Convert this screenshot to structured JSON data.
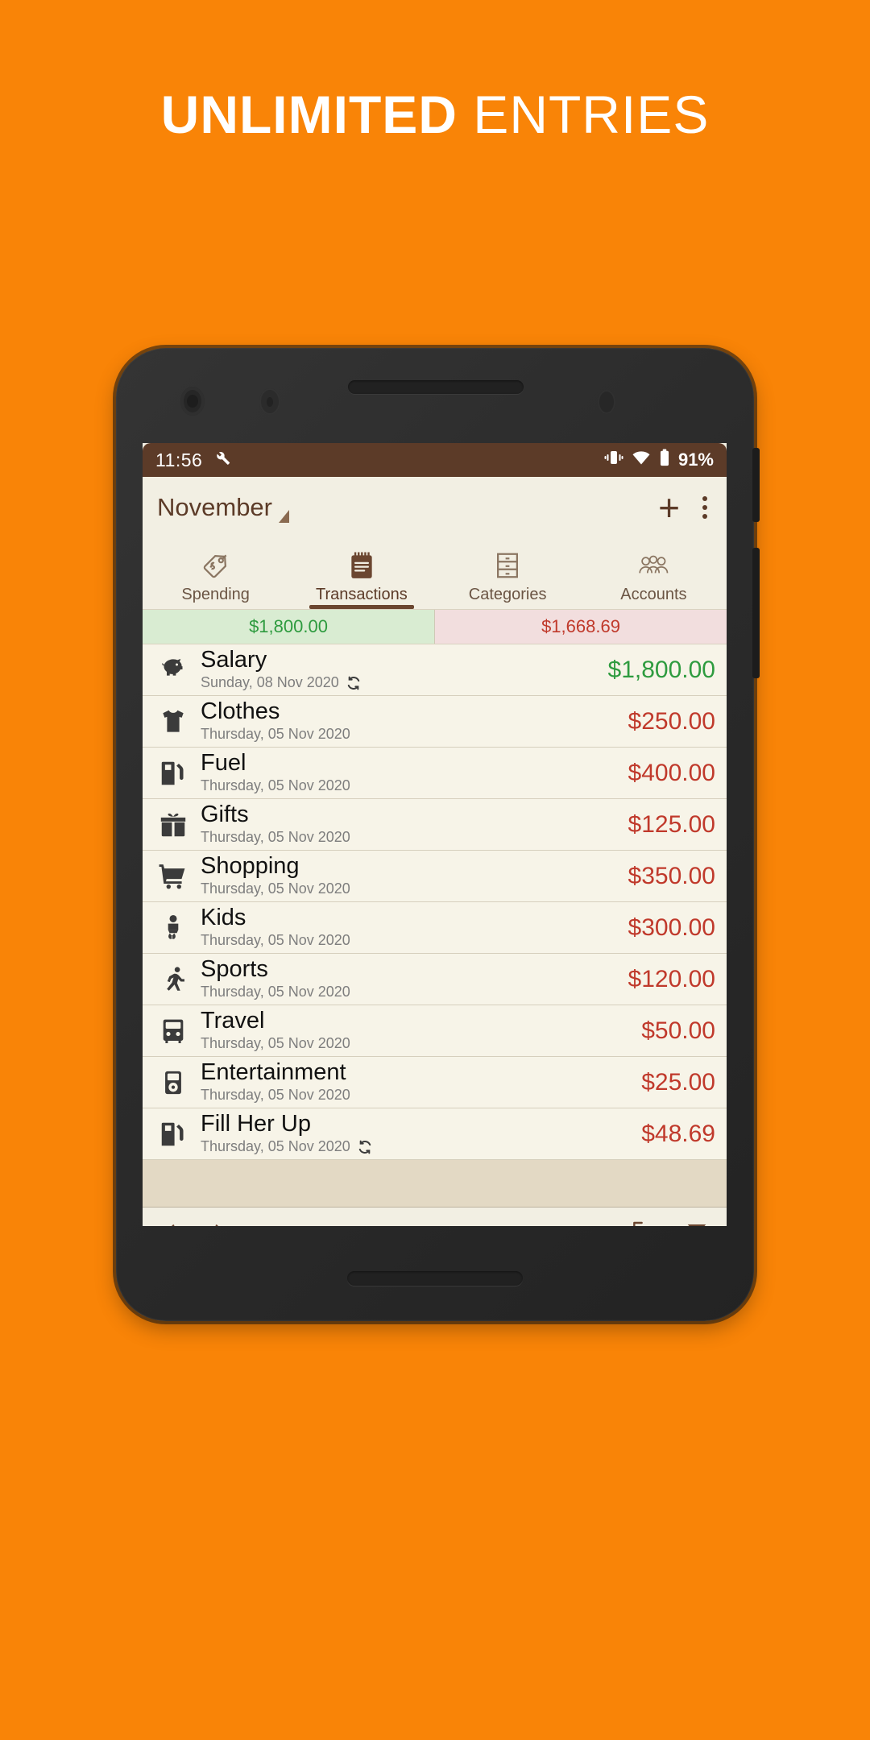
{
  "promo": {
    "headline_bold": "UNLIMITED",
    "headline_light": "ENTRIES"
  },
  "colors": {
    "background_orange": "#f98407",
    "app_bar": "#f2efe3",
    "status_bar": "#5c3b28",
    "accent_brown": "#6b4630",
    "income_green": "#2e9b3f",
    "expense_red": "#c0392b",
    "income_chip_bg": "#d9ecd2",
    "expense_chip_bg": "#f2dede"
  },
  "status_bar": {
    "time": "11:56",
    "wrench_icon": "wrench-icon",
    "vibrate_icon": "vibrate-icon",
    "wifi_icon": "wifi-icon",
    "battery_icon": "battery-icon",
    "battery_percent": "91%"
  },
  "app_bar": {
    "month": "November",
    "dropdown_icon": "dropdown-caret-icon",
    "add_label": "+",
    "overflow_icon": "overflow-menu-icon"
  },
  "tabs": [
    {
      "label": "Spending",
      "icon": "price-tag-icon",
      "active": false
    },
    {
      "label": "Transactions",
      "icon": "notepad-icon",
      "active": true
    },
    {
      "label": "Categories",
      "icon": "file-cabinet-icon",
      "active": false
    },
    {
      "label": "Accounts",
      "icon": "people-icon",
      "active": false
    }
  ],
  "summary": {
    "income_total": "$1,800.00",
    "expense_total": "$1,668.69"
  },
  "transactions": [
    {
      "title": "Salary",
      "date": "Sunday, 08 Nov 2020",
      "amount": "$1,800.00",
      "type": "income",
      "icon": "piggy-bank-icon",
      "recurring": true
    },
    {
      "title": "Clothes",
      "date": "Thursday, 05 Nov 2020",
      "amount": "$250.00",
      "type": "expense",
      "icon": "tshirt-icon",
      "recurring": false
    },
    {
      "title": "Fuel",
      "date": "Thursday, 05 Nov 2020",
      "amount": "$400.00",
      "type": "expense",
      "icon": "fuel-pump-icon",
      "recurring": false
    },
    {
      "title": "Gifts",
      "date": "Thursday, 05 Nov 2020",
      "amount": "$125.00",
      "type": "expense",
      "icon": "gift-icon",
      "recurring": false
    },
    {
      "title": "Shopping",
      "date": "Thursday, 05 Nov 2020",
      "amount": "$350.00",
      "type": "expense",
      "icon": "shopping-cart-icon",
      "recurring": false
    },
    {
      "title": "Kids",
      "date": "Thursday, 05 Nov 2020",
      "amount": "$300.00",
      "type": "expense",
      "icon": "baby-icon",
      "recurring": false
    },
    {
      "title": "Sports",
      "date": "Thursday, 05 Nov 2020",
      "amount": "$120.00",
      "type": "expense",
      "icon": "running-icon",
      "recurring": false
    },
    {
      "title": "Travel",
      "date": "Thursday, 05 Nov 2020",
      "amount": "$50.00",
      "type": "expense",
      "icon": "bus-icon",
      "recurring": false
    },
    {
      "title": "Entertainment",
      "date": "Thursday, 05 Nov 2020",
      "amount": "$25.00",
      "type": "expense",
      "icon": "media-player-icon",
      "recurring": false
    },
    {
      "title": "Fill Her Up",
      "date": "Thursday, 05 Nov 2020",
      "amount": "$48.69",
      "type": "expense",
      "icon": "fuel-pump-icon",
      "recurring": true
    }
  ],
  "toolbar": {
    "prev_icon": "chevron-left-icon",
    "next_icon": "chevron-right-icon",
    "export_icon": "export-icon",
    "filter_icon": "filter-icon"
  },
  "android_nav": {
    "back_icon": "back-triangle-icon",
    "home_icon": "home-circle-icon",
    "recents_icon": "recents-square-icon"
  }
}
